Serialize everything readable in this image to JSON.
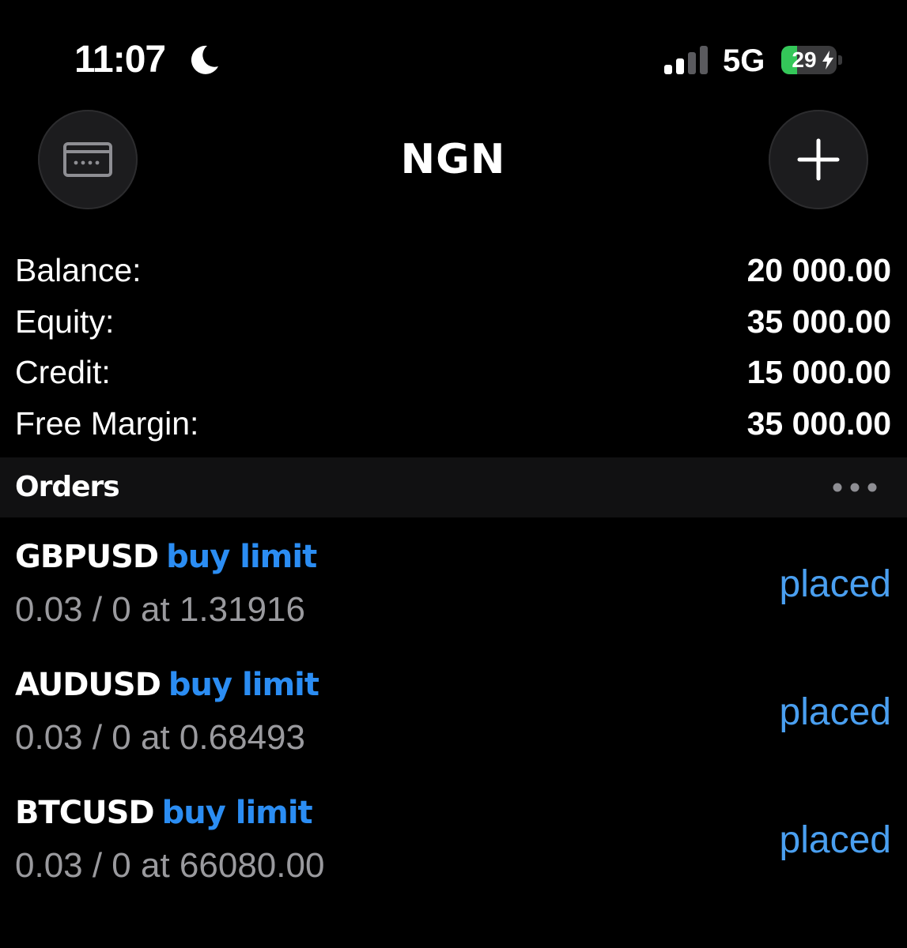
{
  "status_bar": {
    "time": "11:07",
    "focus_icon": "moon-icon",
    "signal_icon": "cellular-signal-icon",
    "signal_bars": 2,
    "signal_bars_total": 4,
    "network": "5G",
    "battery_level": "29",
    "battery_percent": 29,
    "battery_charging": true,
    "battery_color": "#34c759"
  },
  "header": {
    "title": "NGN",
    "left_button_icon": "card-icon",
    "right_button_icon": "plus-icon"
  },
  "account": {
    "rows": [
      {
        "label": "Balance:",
        "value": "20 000.00"
      },
      {
        "label": "Equity:",
        "value": "35 000.00"
      },
      {
        "label": "Credit:",
        "value": "15 000.00"
      },
      {
        "label": "Free Margin:",
        "value": "35 000.00"
      }
    ]
  },
  "orders": {
    "title": "Orders",
    "more_icon": "more-horizontal-icon",
    "accent_color": "#2b8df3",
    "items": [
      {
        "symbol": "GBPUSD",
        "type": "buy limit",
        "detail": "0.03 / 0 at 1.31916",
        "status": "placed"
      },
      {
        "symbol": "AUDUSD",
        "type": "buy limit",
        "detail": "0.03 / 0 at 0.68493",
        "status": "placed"
      },
      {
        "symbol": "BTCUSD",
        "type": "buy limit",
        "detail": "0.03 / 0 at 66080.00",
        "status": "placed"
      }
    ]
  }
}
